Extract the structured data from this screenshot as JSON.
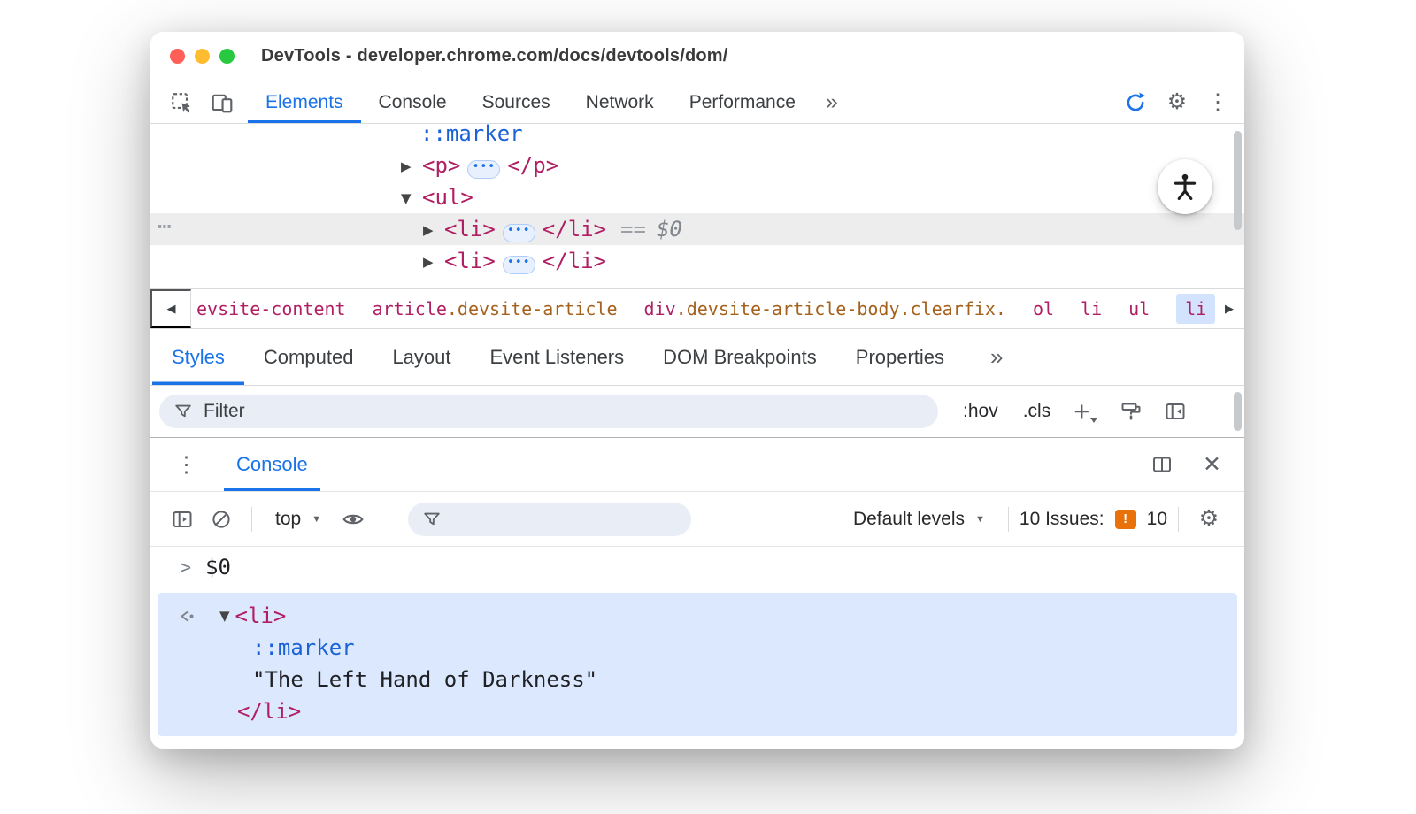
{
  "window": {
    "title": "DevTools - developer.chrome.com/docs/devtools/dom/"
  },
  "colors": {
    "accent": "#1a73e8",
    "tag_pink": "#b01f63",
    "attr_orange": "#a5611b",
    "code_blue": "#1a62d6",
    "icon_gray": "#5f6368",
    "muted_gray": "#9aa0a6",
    "traffic_red": "#ff5f57",
    "traffic_yellow": "#febc2e",
    "traffic_green": "#28c840",
    "issues_orange": "#e8710a",
    "selected_row_bg": "#ededee",
    "result_bg": "#dce8fd",
    "crumb_selected_bg": "#d3e3fd",
    "pill_bg": "#e8f0fe",
    "pill_border": "#aecbfa",
    "field_bg": "#e9eef6"
  },
  "toolbar": {
    "tabs": [
      {
        "label": "Elements",
        "selected": true
      },
      {
        "label": "Console",
        "selected": false
      },
      {
        "label": "Sources",
        "selected": false
      },
      {
        "label": "Network",
        "selected": false
      },
      {
        "label": "Performance",
        "selected": false
      }
    ],
    "more_label": "»"
  },
  "elements_panel": {
    "overflow_dots": "⋯",
    "marker_pseudo": "::marker",
    "p_open": "<p>",
    "p_close": "</p>",
    "ul_open": "<ul>",
    "li_open": "<li>",
    "li_close": "</li>",
    "inline_ellipsis": "•••",
    "equals": "==",
    "selected_ref": "$0"
  },
  "breadcrumbs": {
    "left_arrow": "◀",
    "right_arrow": "▶",
    "items": [
      {
        "tag": "evsite-content",
        "classes": ""
      },
      {
        "tag": "article",
        "classes": ".devsite-article"
      },
      {
        "tag": "div",
        "classes": ".devsite-article-body.clearfix."
      },
      {
        "tag": "ol",
        "classes": ""
      },
      {
        "tag": "li",
        "classes": ""
      },
      {
        "tag": "ul",
        "classes": ""
      },
      {
        "tag": "li",
        "classes": "",
        "selected": true
      }
    ]
  },
  "styles_panel": {
    "tabs": [
      {
        "label": "Styles",
        "selected": true
      },
      {
        "label": "Computed",
        "selected": false
      },
      {
        "label": "Layout",
        "selected": false
      },
      {
        "label": "Event Listeners",
        "selected": false
      },
      {
        "label": "DOM Breakpoints",
        "selected": false
      },
      {
        "label": "Properties",
        "selected": false
      }
    ],
    "more_label": "»",
    "filter_placeholder": "Filter",
    "hov_label": ":hov",
    "cls_label": ".cls",
    "plus_label": "+"
  },
  "console_drawer": {
    "tab_label": "Console",
    "context_selector": "top",
    "filter_placeholder": "",
    "levels_selector": "Default levels",
    "issues_label": "10 Issues:",
    "issues_glyph": "!",
    "issues_count": "10",
    "echo_prompt": ">",
    "echo_expression": "$0",
    "result": {
      "li_open": "<li>",
      "marker_pseudo": "::marker",
      "text_node": "\"The Left Hand of Darkness\"",
      "li_close": "</li>"
    }
  },
  "icons_text": {
    "gear": "⚙",
    "more_vert": "⋮",
    "close": "✕",
    "caret_down": "▼",
    "tree_collapsed": "▶",
    "tree_expanded": "▼"
  }
}
